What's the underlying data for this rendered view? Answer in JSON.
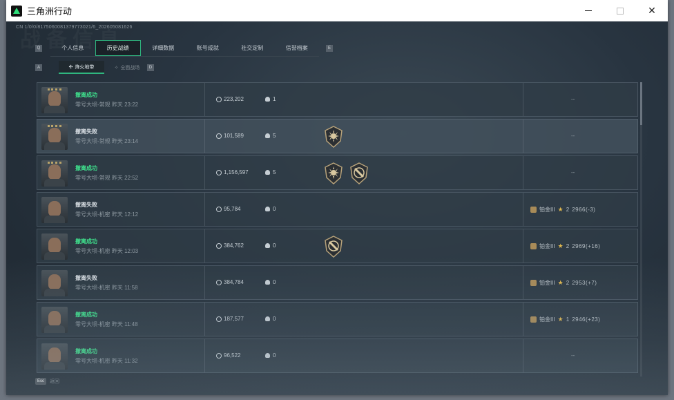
{
  "window": {
    "title": "三角洲行动",
    "minimize": "—",
    "close": "✕"
  },
  "uid": "CN 1/0/0/8175060081379773021/6_202605081626",
  "bg_word": "战备信息",
  "nav_prev_key": "Q",
  "nav_next_key": "E",
  "tabs": [
    {
      "label": "个人信息"
    },
    {
      "label": "历史战绩",
      "active": true
    },
    {
      "label": "详细数据"
    },
    {
      "label": "账号成就"
    },
    {
      "label": "社交定制"
    },
    {
      "label": "信誉档案"
    }
  ],
  "sub_prev_key": "A",
  "sub_next_key": "D",
  "subtabs": [
    {
      "label": "烽火地带",
      "active": true
    },
    {
      "label": "全面战场"
    }
  ],
  "matches": [
    {
      "result": "撤离成功",
      "status": "ok",
      "map": "零号大坝-常规 昨天 23:22",
      "value": "223,202",
      "kills": "1",
      "badges": [],
      "rank": null,
      "dash": "--",
      "avatar": "crown"
    },
    {
      "result": "撤离失败",
      "status": "fail",
      "map": "零号大坝-常规 昨天 23:14",
      "value": "101,589",
      "kills": "5",
      "badges": [
        "sun-badge"
      ],
      "rank": null,
      "dash": "--",
      "avatar": "crown",
      "highlight": true
    },
    {
      "result": "撤离成功",
      "status": "ok",
      "map": "零号大坝-常规 昨天 22:52",
      "value": "1,156,597",
      "kills": "5",
      "badges": [
        "sun-badge",
        "slash-badge"
      ],
      "rank": null,
      "dash": "--",
      "avatar": "crown"
    },
    {
      "result": "撤离失败",
      "status": "fail",
      "map": "零号大坝-机密 昨天 12:12",
      "value": "95,784",
      "kills": "0",
      "badges": [],
      "rank": {
        "tier": "铂金III",
        "level": "2",
        "score": "2966(-3)"
      },
      "avatar": "soldier"
    },
    {
      "result": "撤离成功",
      "status": "ok",
      "map": "零号大坝-机密 昨天 12:03",
      "value": "384,762",
      "kills": "0",
      "badges": [
        "slash-badge"
      ],
      "rank": {
        "tier": "铂金III",
        "level": "2",
        "score": "2969(+16)"
      },
      "avatar": "soldier"
    },
    {
      "result": "撤离失败",
      "status": "fail",
      "map": "零号大坝-机密 昨天 11:58",
      "value": "384,784",
      "kills": "0",
      "badges": [],
      "rank": {
        "tier": "铂金III",
        "level": "2",
        "score": "2953(+7)"
      },
      "avatar": "soldier"
    },
    {
      "result": "撤离成功",
      "status": "ok",
      "map": "零号大坝-机密 昨天 11:48",
      "value": "187,577",
      "kills": "0",
      "badges": [],
      "rank": {
        "tier": "铂金III",
        "level": "1",
        "score": "2946(+23)"
      },
      "avatar": "soldier"
    },
    {
      "result": "撤离成功",
      "status": "ok",
      "map": "零号大坝-机密 昨天 11:32",
      "value": "96,522",
      "kills": "0",
      "badges": [],
      "rank": null,
      "dash": "--",
      "avatar": "soldier"
    }
  ],
  "footer": {
    "esc_key": "Esc",
    "back_label": "返回"
  },
  "colors": {
    "success": "#3fe18d",
    "accent": "#2fb67f",
    "gold": "#e2b94f"
  }
}
